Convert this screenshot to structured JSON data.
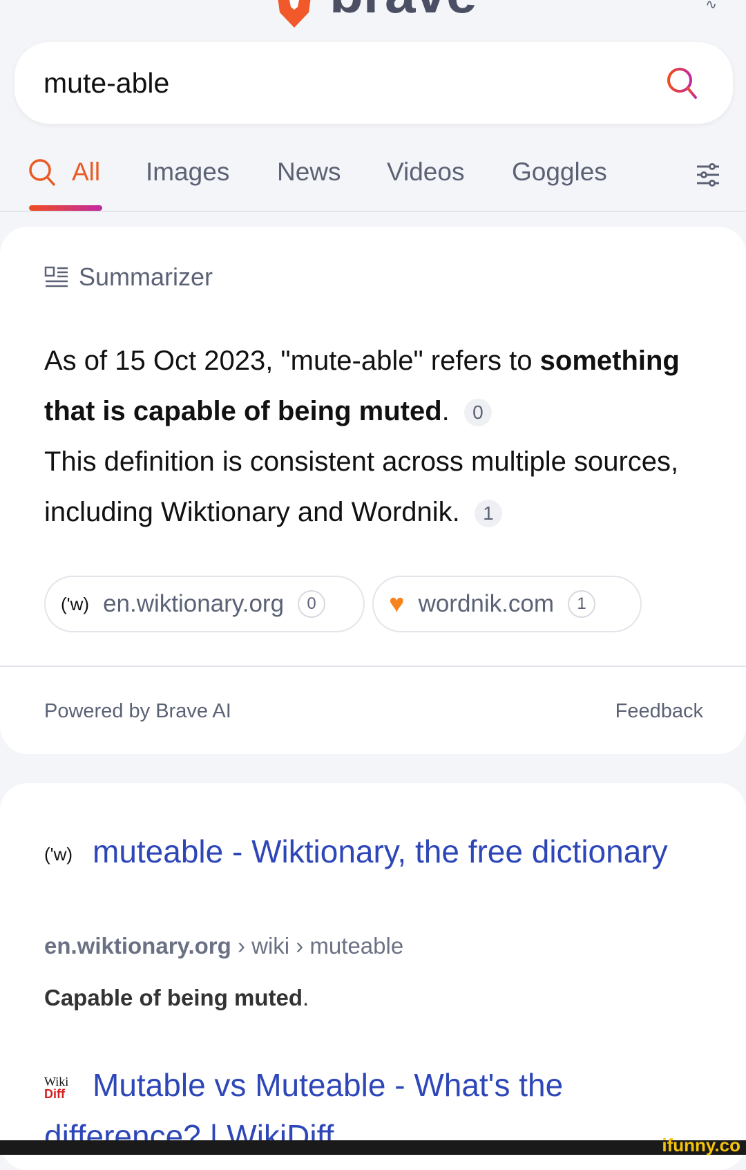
{
  "header": {
    "logo_text": "brave"
  },
  "search": {
    "query": "mute-able"
  },
  "tabs": [
    {
      "label": "All",
      "active": true
    },
    {
      "label": "Images"
    },
    {
      "label": "News"
    },
    {
      "label": "Videos"
    },
    {
      "label": "Goggles"
    }
  ],
  "summarizer": {
    "title": "Summarizer",
    "text_1": "As of 15 Oct 2023, \"mute-able\" refers to ",
    "text_bold": "something that is capable of being muted",
    "text_2": ". ",
    "cite_0": "0",
    "text_3": "This definition is consistent across multiple sources, including Wiktionary and Wordnik. ",
    "cite_1": "1",
    "sources": [
      {
        "favicon": "('w)",
        "domain": "en.wiktionary.org",
        "num": "0"
      },
      {
        "favicon": "heart",
        "domain": "wordnik.com",
        "num": "1"
      }
    ],
    "powered_by": "Powered by Brave AI",
    "feedback": "Feedback"
  },
  "results": [
    {
      "favicon": "('w)",
      "title": "muteable - Wiktionary, the free dictionary",
      "domain": "en.wiktionary.org",
      "path": " › wiki › muteable",
      "description": "Capable of being muted",
      "desc_end": "."
    },
    {
      "favicon_top": "Wiki",
      "favicon_bottom": "Diff",
      "title": "Mutable vs Muteable - What's the difference? | WikiDiff"
    }
  ],
  "watermark": "ifunny.co",
  "colors": {
    "accent": "#e95a25",
    "link": "#2e47b8"
  }
}
